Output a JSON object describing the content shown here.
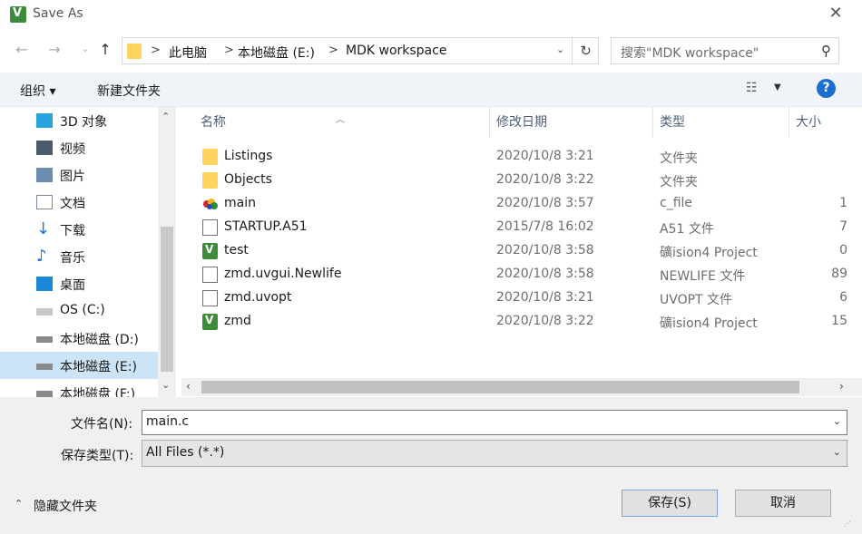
{
  "window": {
    "title": "Save As",
    "close_icon": "close-icon"
  },
  "nav": {
    "breadcrumbs": [
      "此电脑",
      "本地磁盘 (E:)",
      "MDK workspace"
    ],
    "separators": [
      ">",
      ">",
      ">"
    ]
  },
  "search": {
    "placeholder": "搜索\"MDK workspace\""
  },
  "toolbar": {
    "organize": "组织 ▾",
    "new_folder": "新建文件夹",
    "help": "?"
  },
  "sidebar": {
    "items": [
      {
        "label": "3D 对象",
        "icon": "3d-objects-icon"
      },
      {
        "label": "视频",
        "icon": "video-icon"
      },
      {
        "label": "图片",
        "icon": "pictures-icon"
      },
      {
        "label": "文档",
        "icon": "documents-icon"
      },
      {
        "label": "下载",
        "icon": "download-icon"
      },
      {
        "label": "音乐",
        "icon": "music-icon"
      },
      {
        "label": "桌面",
        "icon": "desktop-icon"
      },
      {
        "label": "OS (C:)",
        "icon": "os-drive-icon"
      },
      {
        "label": "本地磁盘 (D:)",
        "icon": "drive-icon"
      },
      {
        "label": "本地磁盘 (E:)",
        "icon": "drive-icon",
        "selected": true
      },
      {
        "label": "本地磁盘 (F:)",
        "icon": "drive-icon"
      }
    ]
  },
  "columns": {
    "name": "名称",
    "date": "修改日期",
    "type": "类型",
    "size": "大小"
  },
  "files": [
    {
      "name": "Listings",
      "date": "2020/10/8 3:21",
      "type": "文件夹",
      "size": "",
      "icon": "folder-icon"
    },
    {
      "name": "Objects",
      "date": "2020/10/8 3:22",
      "type": "文件夹",
      "size": "",
      "icon": "folder-icon"
    },
    {
      "name": "main",
      "date": "2020/10/8 3:57",
      "type": "c_file",
      "size": "1",
      "icon": "c-file-icon"
    },
    {
      "name": "STARTUP.A51",
      "date": "2015/7/8 16:02",
      "type": "A51 文件",
      "size": "7",
      "icon": "document-icon"
    },
    {
      "name": "test",
      "date": "2020/10/8 3:58",
      "type": "礦ision4 Project",
      "size": "0",
      "icon": "uvision-icon"
    },
    {
      "name": "zmd.uvgui.Newlife",
      "date": "2020/10/8 3:58",
      "type": "NEWLIFE 文件",
      "size": "89",
      "icon": "document-icon"
    },
    {
      "name": "zmd.uvopt",
      "date": "2020/10/8 3:21",
      "type": "UVOPT 文件",
      "size": "6",
      "icon": "document-icon"
    },
    {
      "name": "zmd",
      "date": "2020/10/8 3:22",
      "type": "礦ision4 Project",
      "size": "15",
      "icon": "uvision-icon"
    }
  ],
  "form": {
    "filename_label": "文件名(N):",
    "filename_value": "main.c",
    "filetype_label": "保存类型(T):",
    "filetype_value": "All Files (*.*)"
  },
  "footer": {
    "hide_folders": "隐藏文件夹",
    "save": "保存(S)",
    "cancel": "取消"
  }
}
